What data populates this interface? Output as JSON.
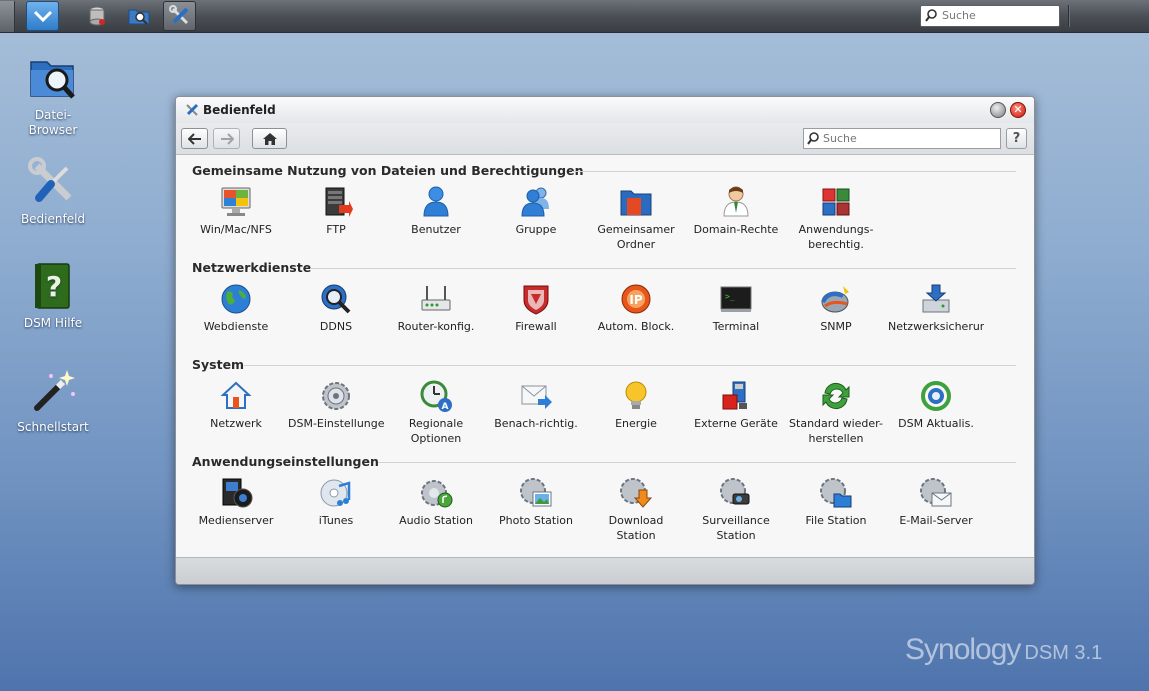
{
  "taskbar": {
    "search_placeholder": "Suche"
  },
  "desktop": {
    "icons": [
      {
        "label": "Datei-\nBrowser"
      },
      {
        "label": "Bedienfeld"
      },
      {
        "label": "DSM Hilfe"
      },
      {
        "label": "Schnellstart"
      }
    ]
  },
  "window": {
    "title": "Bedienfeld",
    "search_placeholder": "Suche",
    "help_label": "?",
    "sections": [
      {
        "title": "Gemeinsame Nutzung von Dateien und Berechtigungen",
        "items": [
          {
            "label": "Win/Mac/NFS",
            "icon": "windows-mac-nfs-icon"
          },
          {
            "label": "FTP",
            "icon": "ftp-icon"
          },
          {
            "label": "Benutzer",
            "icon": "user-icon"
          },
          {
            "label": "Gruppe",
            "icon": "group-icon"
          },
          {
            "label": "Gemeinsamer Ordner",
            "icon": "shared-folder-icon"
          },
          {
            "label": "Domain-Rechte",
            "icon": "domain-rights-icon"
          },
          {
            "label": "Anwendungs-berechtig.",
            "icon": "app-privileges-icon"
          }
        ]
      },
      {
        "title": "Netzwerkdienste",
        "items": [
          {
            "label": "Webdienste",
            "icon": "web-services-icon"
          },
          {
            "label": "DDNS",
            "icon": "ddns-icon"
          },
          {
            "label": "Router-konfig.",
            "icon": "router-icon"
          },
          {
            "label": "Firewall",
            "icon": "firewall-icon"
          },
          {
            "label": "Autom. Block.",
            "icon": "auto-block-icon"
          },
          {
            "label": "Terminal",
            "icon": "terminal-icon"
          },
          {
            "label": "SNMP",
            "icon": "snmp-icon"
          },
          {
            "label": "Netzwerksicherur",
            "icon": "network-backup-icon"
          }
        ]
      },
      {
        "title": "System",
        "items": [
          {
            "label": "Netzwerk",
            "icon": "network-icon"
          },
          {
            "label": "DSM-Einstellunge",
            "icon": "dsm-settings-icon"
          },
          {
            "label": "Regionale Optionen",
            "icon": "regional-options-icon"
          },
          {
            "label": "Benach-richtig.",
            "icon": "notification-icon"
          },
          {
            "label": "Energie",
            "icon": "energy-icon"
          },
          {
            "label": "Externe Geräte",
            "icon": "external-devices-icon"
          },
          {
            "label": "Standard wieder-herstellen",
            "icon": "restore-defaults-icon"
          },
          {
            "label": "DSM Aktualis.",
            "icon": "dsm-update-icon"
          }
        ]
      },
      {
        "title": "Anwendungseinstellungen",
        "items": [
          {
            "label": "Medienserver",
            "icon": "media-server-icon"
          },
          {
            "label": "iTunes",
            "icon": "itunes-icon"
          },
          {
            "label": "Audio Station",
            "icon": "audio-station-icon"
          },
          {
            "label": "Photo Station",
            "icon": "photo-station-icon"
          },
          {
            "label": "Download Station",
            "icon": "download-station-icon"
          },
          {
            "label": "Surveillance Station",
            "icon": "surveillance-station-icon"
          },
          {
            "label": "File Station",
            "icon": "file-station-icon"
          },
          {
            "label": "E-Mail-Server",
            "icon": "mail-server-icon"
          }
        ]
      }
    ]
  },
  "brand": {
    "name": "Synology",
    "product": "DSM 3.1"
  }
}
